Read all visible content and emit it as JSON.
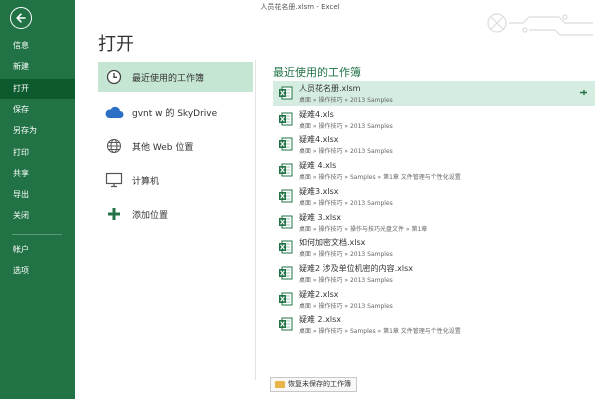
{
  "window": {
    "title": "人员花名册.xlsm - Excel"
  },
  "sidebar": {
    "items": [
      {
        "label": "信息"
      },
      {
        "label": "新建"
      },
      {
        "label": "打开"
      },
      {
        "label": "保存"
      },
      {
        "label": "另存为"
      },
      {
        "label": "打印"
      },
      {
        "label": "共享"
      },
      {
        "label": "导出"
      },
      {
        "label": "关闭"
      },
      {
        "label": "帐户"
      },
      {
        "label": "选项"
      }
    ],
    "active_index": 2
  },
  "page": {
    "title": "打开"
  },
  "locations": [
    {
      "label": "最近使用的工作簿",
      "icon": "clock-icon",
      "selected": true
    },
    {
      "label": "gvnt w 的 SkyDrive",
      "icon": "cloud-icon",
      "selected": false
    },
    {
      "label": "其他 Web 位置",
      "icon": "globe-icon",
      "selected": false
    },
    {
      "label": "计算机",
      "icon": "computer-icon",
      "selected": false
    },
    {
      "label": "添加位置",
      "icon": "plus-icon",
      "selected": false
    }
  ],
  "recent": {
    "title": "最近使用的工作簿",
    "files": [
      {
        "name": "人员花名册.xlsm",
        "path": "桌面 » 操作技巧 » 2013 Samples"
      },
      {
        "name": "疑难4.xls",
        "path": "桌面 » 操作技巧 » 2013 Samples"
      },
      {
        "name": "疑难4.xlsx",
        "path": "桌面 » 操作技巧 » 2013 Samples"
      },
      {
        "name": "疑难 4.xls",
        "path": "桌面 » 操作技巧 » Samples » 第1章 文件管理与个性化设置"
      },
      {
        "name": "疑难3.xlsx",
        "path": "桌面 » 操作技巧 » 2013 Samples"
      },
      {
        "name": "疑难 3.xlsx",
        "path": "桌面 » 操作技巧 » 操作与技巧光盘文件 » 第1章"
      },
      {
        "name": "如何加密文档.xlsx",
        "path": "桌面 » 操作技巧 » 2013 Samples"
      },
      {
        "name": "疑难2 涉及单位机密的内容.xlsx",
        "path": "桌面 » 操作技巧 » 2013 Samples"
      },
      {
        "name": "疑难2.xlsx",
        "path": "桌面 » 操作技巧 » 2013 Samples"
      },
      {
        "name": "疑难 2.xlsx",
        "path": "桌面 » 操作技巧 » Samples » 第1章 文件管理与个性化设置"
      }
    ]
  },
  "recover_button": {
    "label": "恢复未保存的工作簿"
  },
  "colors": {
    "brand": "#217346",
    "brand_dark": "#0e5a2f",
    "selected": "#c5e6d3"
  }
}
